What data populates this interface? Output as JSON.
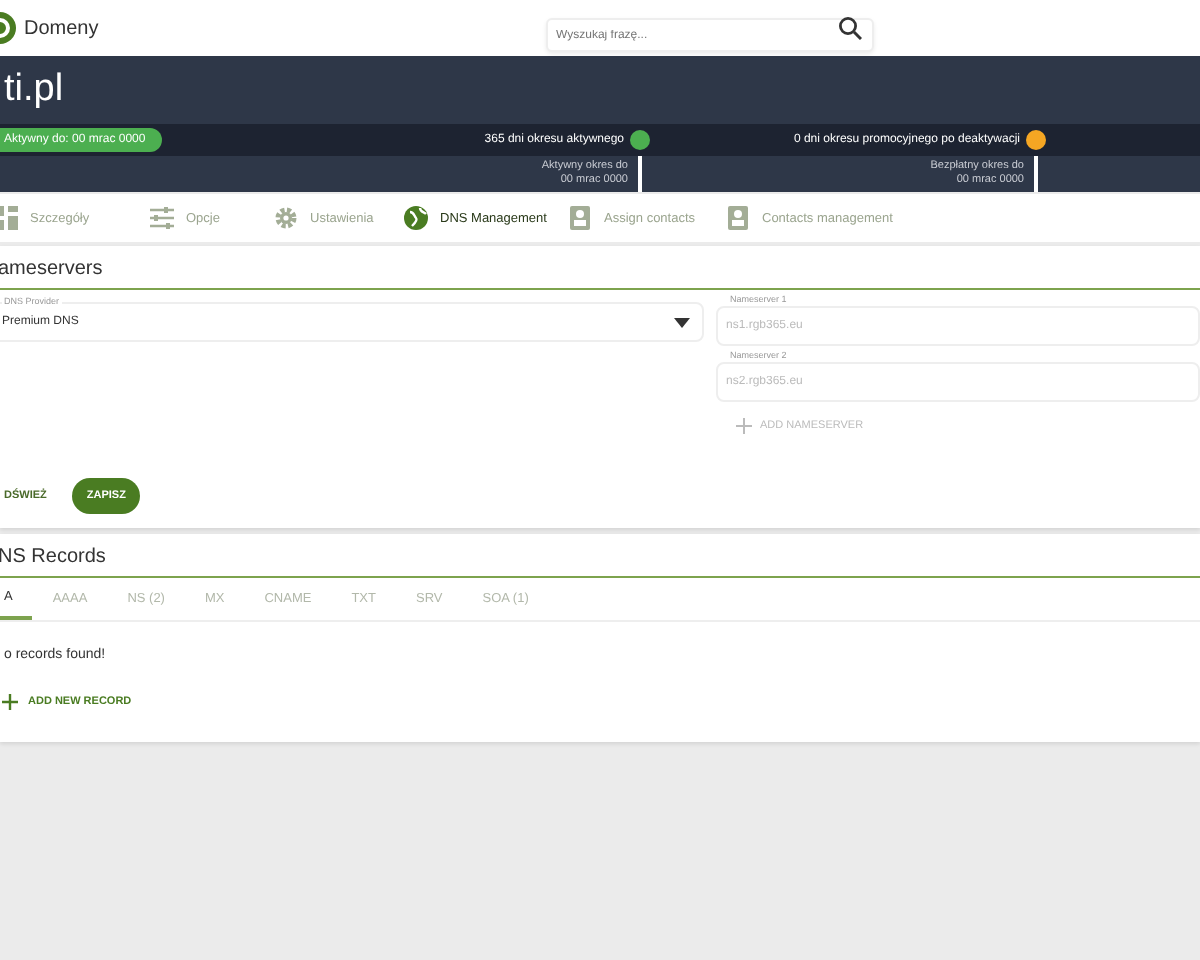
{
  "header": {
    "app_name": "Domeny",
    "search": {
      "placeholder": "Wyszukaj frazę..."
    }
  },
  "domain": {
    "title": "ti.pl",
    "status_pill": "Aktywny do: 00 mrac 0000",
    "markers": [
      {
        "label": "365 dni okresu aktywnego",
        "color": "#4caf50",
        "caption": [
          "Aktywny okres do",
          "00 mrac 0000"
        ]
      },
      {
        "label": "0 dni okresu promocyjnego po deaktywacji",
        "color": "#f5a623",
        "caption": [
          "Bezpłatny okres do",
          "00 mrac 0000"
        ]
      }
    ]
  },
  "nav_tabs": [
    {
      "label": "Szczegóły",
      "selected": false
    },
    {
      "label": "Opcje",
      "selected": false
    },
    {
      "label": "Ustawienia",
      "selected": false
    },
    {
      "label": "DNS Management",
      "selected": true
    },
    {
      "label": "Assign contacts",
      "selected": false
    },
    {
      "label": "Contacts management",
      "selected": false
    }
  ],
  "nameservers": {
    "title": "ameservers",
    "provider": {
      "label": "DNS Provider",
      "value": "Premium DNS"
    },
    "fields": [
      {
        "label": "Nameserver 1",
        "placeholder": "ns1.rgb365.eu"
      },
      {
        "label": "Nameserver 2",
        "placeholder": "ns2.rgb365.eu"
      }
    ],
    "add_button": "ADD NAMESERVER",
    "refresh_button": "DŚWIEŻ",
    "save_button": "ZAPISZ"
  },
  "dns_records": {
    "title": "NS Records",
    "tabs": [
      {
        "label": "A",
        "selected": true
      },
      {
        "label": "AAAA",
        "selected": false
      },
      {
        "label": "NS (2)",
        "selected": false
      },
      {
        "label": "MX",
        "selected": false
      },
      {
        "label": "CNAME",
        "selected": false
      },
      {
        "label": "TXT",
        "selected": false
      },
      {
        "label": "SRV",
        "selected": false
      },
      {
        "label": "SOA (1)",
        "selected": false
      }
    ],
    "empty_message": "o records found!",
    "add_button": "ADD NEW RECORD"
  }
}
